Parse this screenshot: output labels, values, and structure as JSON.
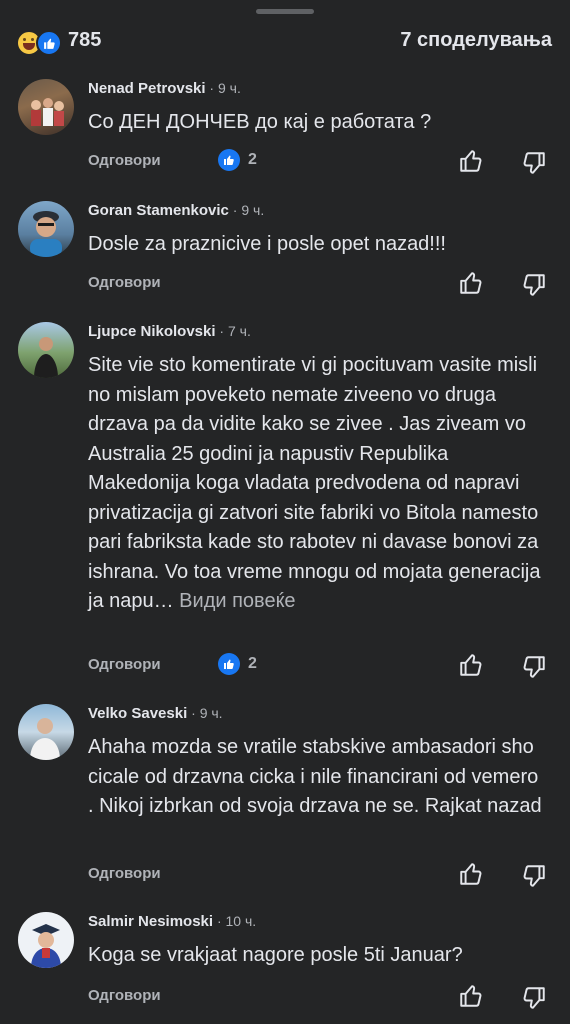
{
  "header": {
    "reactions_count": "785",
    "shares": "7 споделувања",
    "reaction_icons": [
      "haha-icon",
      "like-icon"
    ]
  },
  "reply_label": "Одговори",
  "comments": [
    {
      "name": "Nenad Petrovski",
      "time": "9 ч.",
      "text": "Со ДЕН ДОНЧЕВ до кај е работата ?",
      "likes": "2"
    },
    {
      "name": "Goran Stamenkovic",
      "time": "9 ч.",
      "text": "Dosle za praznicive i posle opet nazad!!!",
      "likes": ""
    },
    {
      "name": "Ljupce Nikolovski",
      "time": "7 ч.",
      "text": "Site vie sto komentirate vi gi pocituvam vasite misli no mislam poveketo nemate ziveeno vo druga drzava pa da vidite kako se zivee .  Jas ziveam vo Australia 25 godini ja napustiv Republika Makedonija koga vladata predvodena od napravi privatizacija gi zatvori site fabriki vo Bitola namesto pari fabriksta kade sto rabotev ni davase bonovi za ishrana. Vo toa vreme mnogu od mojata generacija ja napu…",
      "more": " Види повеќе",
      "likes": "2"
    },
    {
      "name": "Velko Saveski",
      "time": "9 ч.",
      "text": "Ahaha mozda se vratile stabskive ambasadori sho cicale od drzavna cicka i nile financirani od vemero . Nikoj izbrkan od svoja drzava ne se. Rajkat nazad",
      "likes": ""
    },
    {
      "name": "Salmir Nesimoski",
      "time": "10 ч.",
      "text": "Koga se vrakjaat nagore posle 5ti Januar?",
      "likes": ""
    }
  ],
  "colors": {
    "background": "#242526",
    "text": "#e4e6eb",
    "secondary": "#b0b3b8",
    "like_blue": "#1877f2"
  }
}
